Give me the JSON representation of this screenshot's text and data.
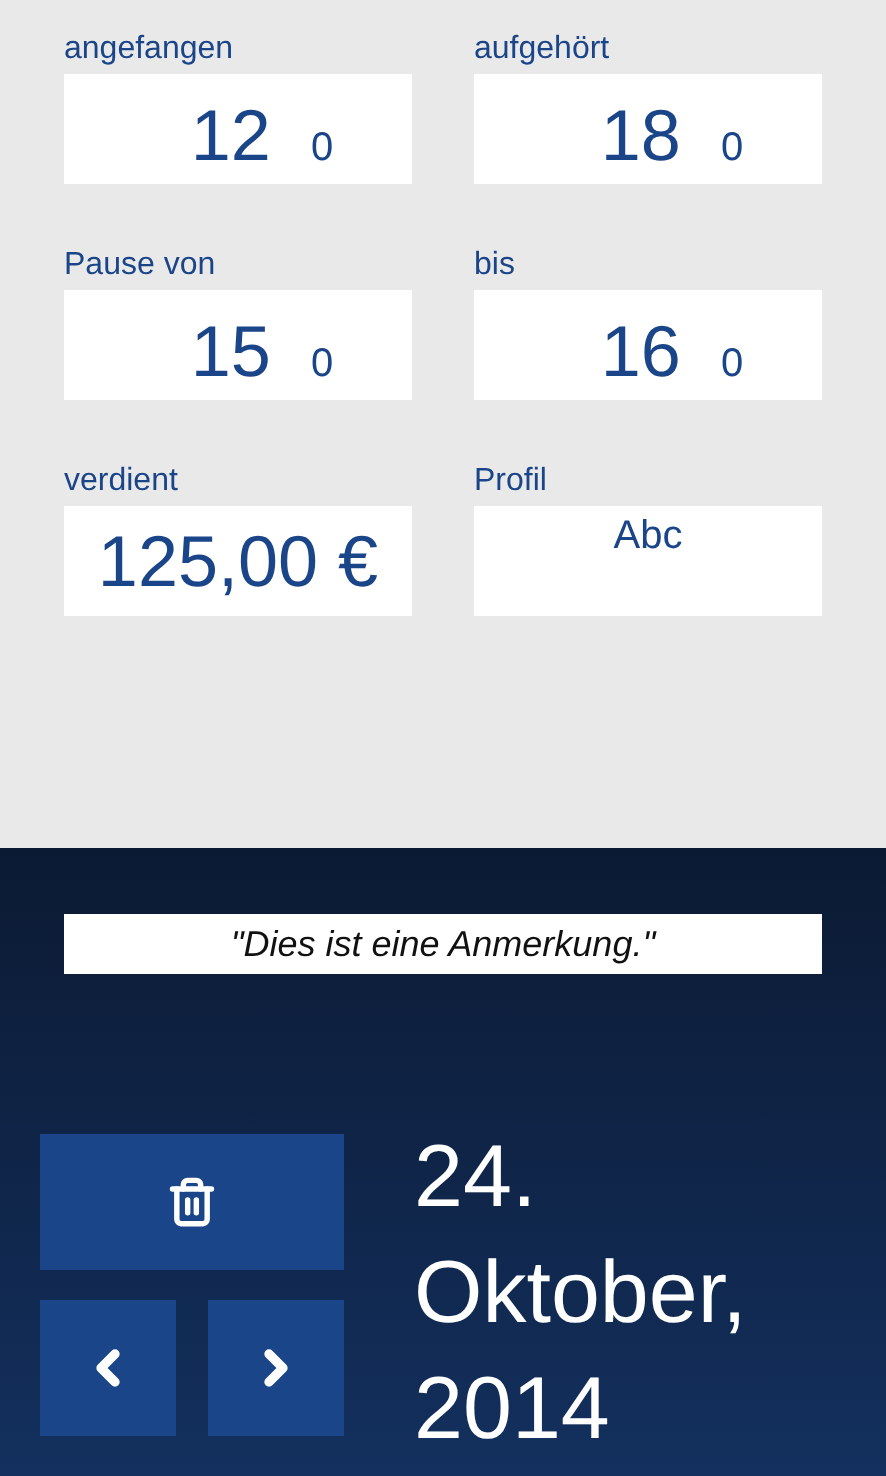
{
  "fields": [
    {
      "kind": "time",
      "label": "angefangen",
      "hour": "12",
      "minute": "0"
    },
    {
      "kind": "time",
      "label": "aufgehört",
      "hour": "18",
      "minute": "0"
    },
    {
      "kind": "time",
      "label": "Pause von",
      "hour": "15",
      "minute": "0"
    },
    {
      "kind": "time",
      "label": "bis",
      "hour": "16",
      "minute": "0"
    },
    {
      "kind": "amount",
      "label": "verdient",
      "value": "125,00 €"
    },
    {
      "kind": "profile",
      "label": "Profil",
      "value": "Abc"
    }
  ],
  "note": "\"Dies ist eine Anmerkung.\"",
  "date": "24. Oktober, 2014"
}
